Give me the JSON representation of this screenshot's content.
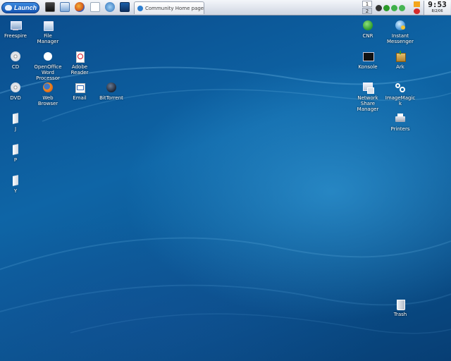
{
  "taskbar": {
    "launch_label": "Launch",
    "task_title": "Community Home page",
    "pager": [
      "1",
      "2"
    ],
    "clock_time": "9:53",
    "clock_date": "8/2/06"
  },
  "desktop": {
    "left_icons": [
      {
        "label": "Freespire",
        "icon": "computer-icon"
      },
      {
        "label": "File Manager",
        "icon": "folder-home-icon"
      },
      {
        "label": "CD",
        "icon": "cd-icon"
      },
      {
        "label": "OpenOffice Word Processor",
        "icon": "openoffice-icon"
      },
      {
        "label": "Adobe Reader",
        "icon": "adobe-reader-icon"
      },
      {
        "label": "DVD",
        "icon": "dvd-icon"
      },
      {
        "label": "Web Browser",
        "icon": "firefox-icon"
      },
      {
        "label": "Email",
        "icon": "email-icon"
      },
      {
        "label": "BitTorrent",
        "icon": "bittorrent-icon"
      },
      {
        "label": "J",
        "icon": "drive-icon"
      },
      {
        "label": "P",
        "icon": "drive-icon"
      },
      {
        "label": "Y",
        "icon": "drive-icon"
      }
    ],
    "right_icons": [
      {
        "label": "CNR",
        "icon": "cnr-icon"
      },
      {
        "label": "Instant Messenger",
        "icon": "instant-messenger-icon"
      },
      {
        "label": "Konsole",
        "icon": "terminal-icon"
      },
      {
        "label": "Ark",
        "icon": "archive-icon"
      },
      {
        "label": "Network Share Manager",
        "icon": "network-share-icon"
      },
      {
        "label": "ImageMagick",
        "icon": "imagemagick-icon"
      },
      {
        "label": "Printers",
        "icon": "printer-icon"
      }
    ],
    "trash_label": "Trash"
  }
}
